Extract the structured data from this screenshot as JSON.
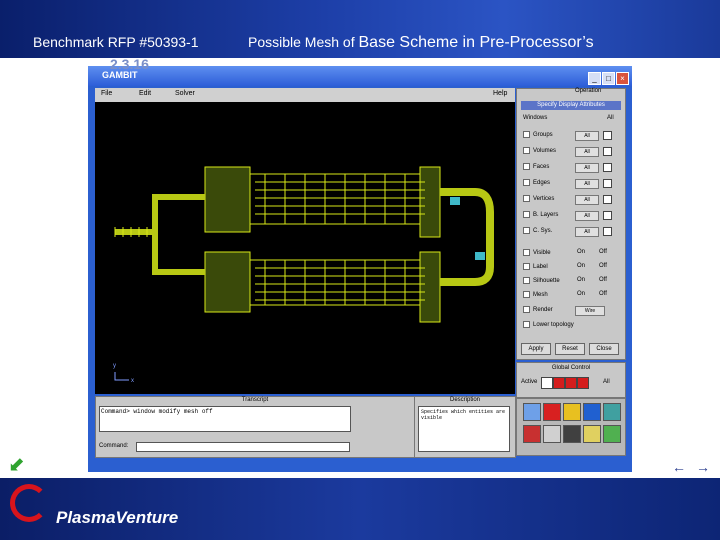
{
  "header": {
    "left_text": "Benchmark  RFP #50393-1",
    "title_small": "Possible Mesh of",
    "title_big": "Base Scheme in Pre-Processor’s"
  },
  "footer": {
    "logo_text": "PlasmaVenture"
  },
  "nav": {
    "prev": "←",
    "next": "→",
    "back": "⬋"
  },
  "window": {
    "title": "GAMBIT",
    "ghost_text": "2.3.16",
    "menus": [
      "File",
      "Edit",
      "Solver",
      "Help"
    ],
    "operation_label": "Operation",
    "panel_title": "Specify Display Attributes",
    "windows_label": "Windows",
    "all_label": "All",
    "entity_rows": [
      {
        "label": "Groups",
        "value": "All"
      },
      {
        "label": "Volumes",
        "value": "All"
      },
      {
        "label": "Faces",
        "value": "All"
      },
      {
        "label": "Edges",
        "value": "All"
      },
      {
        "label": "Vertices",
        "value": "All"
      },
      {
        "label": "B. Layers",
        "value": "All"
      },
      {
        "label": "C. Sys.",
        "value": "All"
      }
    ],
    "attr_rows": [
      {
        "label": "Visible",
        "on": "On",
        "off": "Off"
      },
      {
        "label": "Label",
        "on": "On",
        "off": "Off"
      },
      {
        "label": "Silhouette",
        "on": "On",
        "off": "Off"
      },
      {
        "label": "Mesh",
        "on": "On",
        "off": "Off"
      }
    ],
    "render_label": "Render",
    "render_value": "Wire",
    "lower_topology": "Lower topology",
    "buttons": {
      "apply": "Apply",
      "reset": "Reset",
      "close": "Close"
    },
    "global_control": "Global Control",
    "active_label": "Active",
    "transcript_title": "Transcript",
    "transcript_text": "Command> window modify mesh off",
    "command_label": "Command:",
    "description_title": "Description",
    "description_text": "Specifies which entities are visible"
  }
}
